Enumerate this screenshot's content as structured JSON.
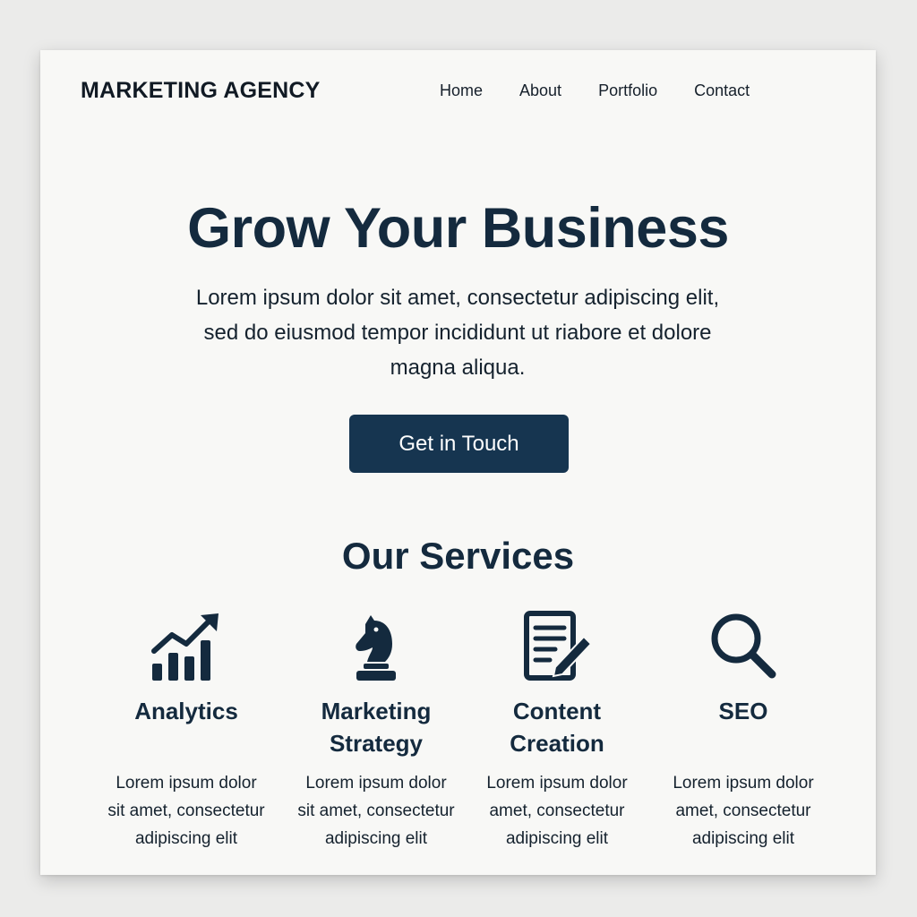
{
  "header": {
    "brand": "MARKETING AGENCY",
    "nav": [
      "Home",
      "About",
      "Portfolio",
      "Contact"
    ]
  },
  "hero": {
    "title": "Grow Your Business",
    "text_line1": "Lorem ipsum dolor sit amet, consectetur adipiscing elit,",
    "text_line2": "sed do eiusmod tempor incididunt ut riabore et dolore",
    "text_line3": "magna aliqua.",
    "cta_label": "Get in Touch"
  },
  "services": {
    "title": "Our Services",
    "items": [
      {
        "icon": "chart-icon",
        "name_line1": "Analytics",
        "name_line2": "",
        "desc_line1": "Lorem ipsum dolor",
        "desc_line2": "sit amet, consectetur",
        "desc_line3": "adipiscing elit"
      },
      {
        "icon": "chess-knight-icon",
        "name_line1": "Marketing",
        "name_line2": "Strategy",
        "desc_line1": "Lorem ipsum dolor",
        "desc_line2": "sit amet, consectetur",
        "desc_line3": "adipiscing elit"
      },
      {
        "icon": "document-edit-icon",
        "name_line1": "Content",
        "name_line2": "Creation",
        "desc_line1": "Lorem ipsum dolor",
        "desc_line2": "amet, consectetur",
        "desc_line3": "adipiscing elit"
      },
      {
        "icon": "search-icon",
        "name_line1": "SEO",
        "name_line2": "",
        "desc_line1": "Lorem ipsum dolor",
        "desc_line2": "amet, consectetur",
        "desc_line3": "adipiscing elit"
      }
    ]
  },
  "colors": {
    "primary": "#163550",
    "heading": "#142a3e",
    "background": "#f8f8f6",
    "button_text": "#ffffff"
  }
}
